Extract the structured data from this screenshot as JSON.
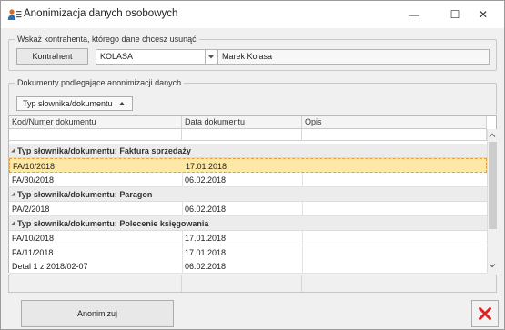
{
  "window": {
    "title": "Anonimizacja danych osobowych",
    "controls": {
      "minimize": "—",
      "maximize": "☐",
      "close": "✕"
    }
  },
  "contractor_group": {
    "title": "Wskaż kontrahenta, którego dane chcesz usunąć",
    "button_label": "Kontrahent",
    "code_value": "KOLASA",
    "name_value": "Marek Kolasa"
  },
  "documents_group": {
    "title": "Dokumenty podlegające anonimizacji danych",
    "grouping_chip": "Typ słownika/dokumentu",
    "columns": [
      "Kod/Numer dokumentu",
      "Data dokumentu",
      "Opis"
    ],
    "groups": [
      {
        "label": "Typ słownika/dokumentu: Faktura sprzedaży",
        "rows": [
          {
            "code": "FA/10/2018",
            "date": "17.01.2018",
            "desc": "",
            "selected": true
          },
          {
            "code": "FA/30/2018",
            "date": "06.02.2018",
            "desc": "",
            "selected": false
          }
        ]
      },
      {
        "label": "Typ słownika/dokumentu: Paragon",
        "rows": [
          {
            "code": "PA/2/2018",
            "date": "06.02.2018",
            "desc": "",
            "selected": false
          }
        ]
      },
      {
        "label": "Typ słownika/dokumentu: Polecenie księgowania",
        "rows": [
          {
            "code": "FA/10/2018",
            "date": "17.01.2018",
            "desc": "",
            "selected": false
          },
          {
            "code": "FA/11/2018",
            "date": "17.01.2018",
            "desc": "",
            "selected": false
          },
          {
            "code": "Detal 1  z 2018/02-07",
            "date": "06.02.2018",
            "desc": "",
            "selected": false
          }
        ]
      }
    ]
  },
  "actions": {
    "anonymize_label": "Anonimizuj",
    "close_icon_color": "#e02020"
  }
}
